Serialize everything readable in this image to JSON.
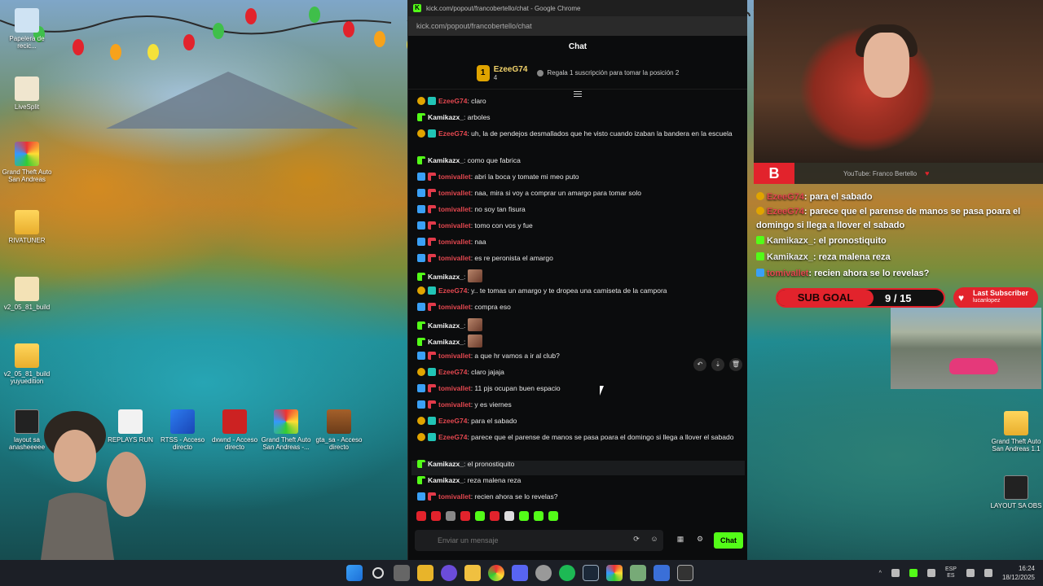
{
  "desktop": {
    "icons": [
      {
        "label": "Papelera de recic..."
      },
      {
        "label": "LiveSplit"
      },
      {
        "label": "Grand Theft Auto San Andreas"
      },
      {
        "label": "RIVATUNER"
      },
      {
        "label": "v2_05_81_build"
      },
      {
        "label": "v2_05_81_build yuyuedition"
      },
      {
        "label": "layout sa anasheeeee"
      },
      {
        "label": "REPLAYS RUN"
      },
      {
        "label": "RTSS - Acceso directo"
      },
      {
        "label": "dxwnd - Acceso directo"
      },
      {
        "label": "Grand Theft Auto San Andreas -..."
      },
      {
        "label": "gta_sa - Acceso directo"
      },
      {
        "label": "Grand Theft Auto San Andreas 1.1"
      },
      {
        "label": "LAYOUT SA OBS"
      }
    ]
  },
  "browser": {
    "title": "kick.com/popout/francobertello/chat - Google Chrome",
    "url": "kick.com/popout/francobertello/chat"
  },
  "chat": {
    "heading": "Chat",
    "leaderboard": {
      "rank": "1",
      "user": "EzeeG74",
      "count": "4",
      "hint": "Regala 1 suscripción para tomar la posición 2"
    },
    "messages": [
      {
        "user": "EzeeG74",
        "text": ": claro",
        "kind": "gold"
      },
      {
        "user": "Kamikazx_",
        "text": ": arboles",
        "kind": "green"
      },
      {
        "user": "EzeeG74",
        "text": ": uh, la de pendejos desmallados que he visto cuando izaban la bandera en la escuela",
        "kind": "gold"
      },
      {
        "user": "Kamikazx_",
        "text": ": como que fabrica",
        "kind": "green"
      },
      {
        "user": "tomivallet",
        "text": ": abri la boca y tomate mi meo puto",
        "kind": "blue"
      },
      {
        "user": "tomivallet",
        "text": ": naa, mira si voy a comprar un amargo para tomar solo",
        "kind": "blue"
      },
      {
        "user": "tomivallet",
        "text": ": no soy tan fisura",
        "kind": "blue"
      },
      {
        "user": "tomivallet",
        "text": ": tomo con vos y fue",
        "kind": "blue"
      },
      {
        "user": "tomivallet",
        "text": ": naa",
        "kind": "blue"
      },
      {
        "user": "tomivallet",
        "text": ": es re peronista el amargo",
        "kind": "blue"
      },
      {
        "user": "Kamikazx_",
        "text": ":",
        "kind": "green",
        "emote": true
      },
      {
        "user": "EzeeG74",
        "text": ": y.. te tomas un amargo y te dropea una camiseta de la campora",
        "kind": "gold"
      },
      {
        "user": "tomivallet",
        "text": ": compra eso",
        "kind": "blue"
      },
      {
        "user": "Kamikazx_",
        "text": ":",
        "kind": "green",
        "emote": true
      },
      {
        "user": "Kamikazx_",
        "text": ":",
        "kind": "green",
        "emote": true
      },
      {
        "user": "tomivallet",
        "text": ": a que hr vamos a ir al club?",
        "kind": "blue"
      },
      {
        "user": "EzeeG74",
        "text": ": claro jajaja",
        "kind": "gold"
      },
      {
        "user": "tomivallet",
        "text": ": 11 pjs ocupan buen espacio",
        "kind": "blue"
      },
      {
        "user": "tomivallet",
        "text": ": y es viernes",
        "kind": "blue"
      },
      {
        "user": "EzeeG74",
        "text": ": para el sabado",
        "kind": "gold"
      },
      {
        "user": "EzeeG74",
        "text": ": parece que el parense de manos se pasa poara el domingo si llega a llover el sabado",
        "kind": "gold"
      },
      {
        "user": "Kamikazx_",
        "text": ": el pronostiquito",
        "kind": "green"
      },
      {
        "user": "Kamikazx_",
        "text": ": reza malena reza",
        "kind": "green"
      },
      {
        "user": "tomivallet",
        "text": ": recien ahora se lo revelas?",
        "kind": "blue"
      }
    ],
    "input_placeholder": "Enviar un mensaje",
    "send_label": "Chat"
  },
  "overlay": {
    "source": "YouTube: Franco Bertello",
    "chat": [
      {
        "user": "EzeeG74",
        "text": ": para el sabado"
      },
      {
        "user": "EzeeG74",
        "text": ": parece que el parense de manos se pasa poara el domingo si llega a llover el sabado"
      },
      {
        "user": "Kamikazx_",
        "text": ": el pronostiquito"
      },
      {
        "user": "Kamikazx_",
        "text": ": reza malena reza"
      },
      {
        "user": "tomivallet",
        "text": ": recien ahora se lo revelas?"
      }
    ],
    "sub_goal_label": "SUB GOAL",
    "sub_goal_value": "9 / 15",
    "last_sub_label": "Last Subscriber",
    "last_sub_user": "lucanlopez"
  },
  "taskbar": {
    "lang_top": "ESP",
    "lang_bottom": "ES",
    "time": "16:24",
    "date": "18/12/2025"
  },
  "colors": {
    "kick_green": "#53fc18",
    "username_red": "#e3474f",
    "overlay_red": "#e2232c"
  }
}
